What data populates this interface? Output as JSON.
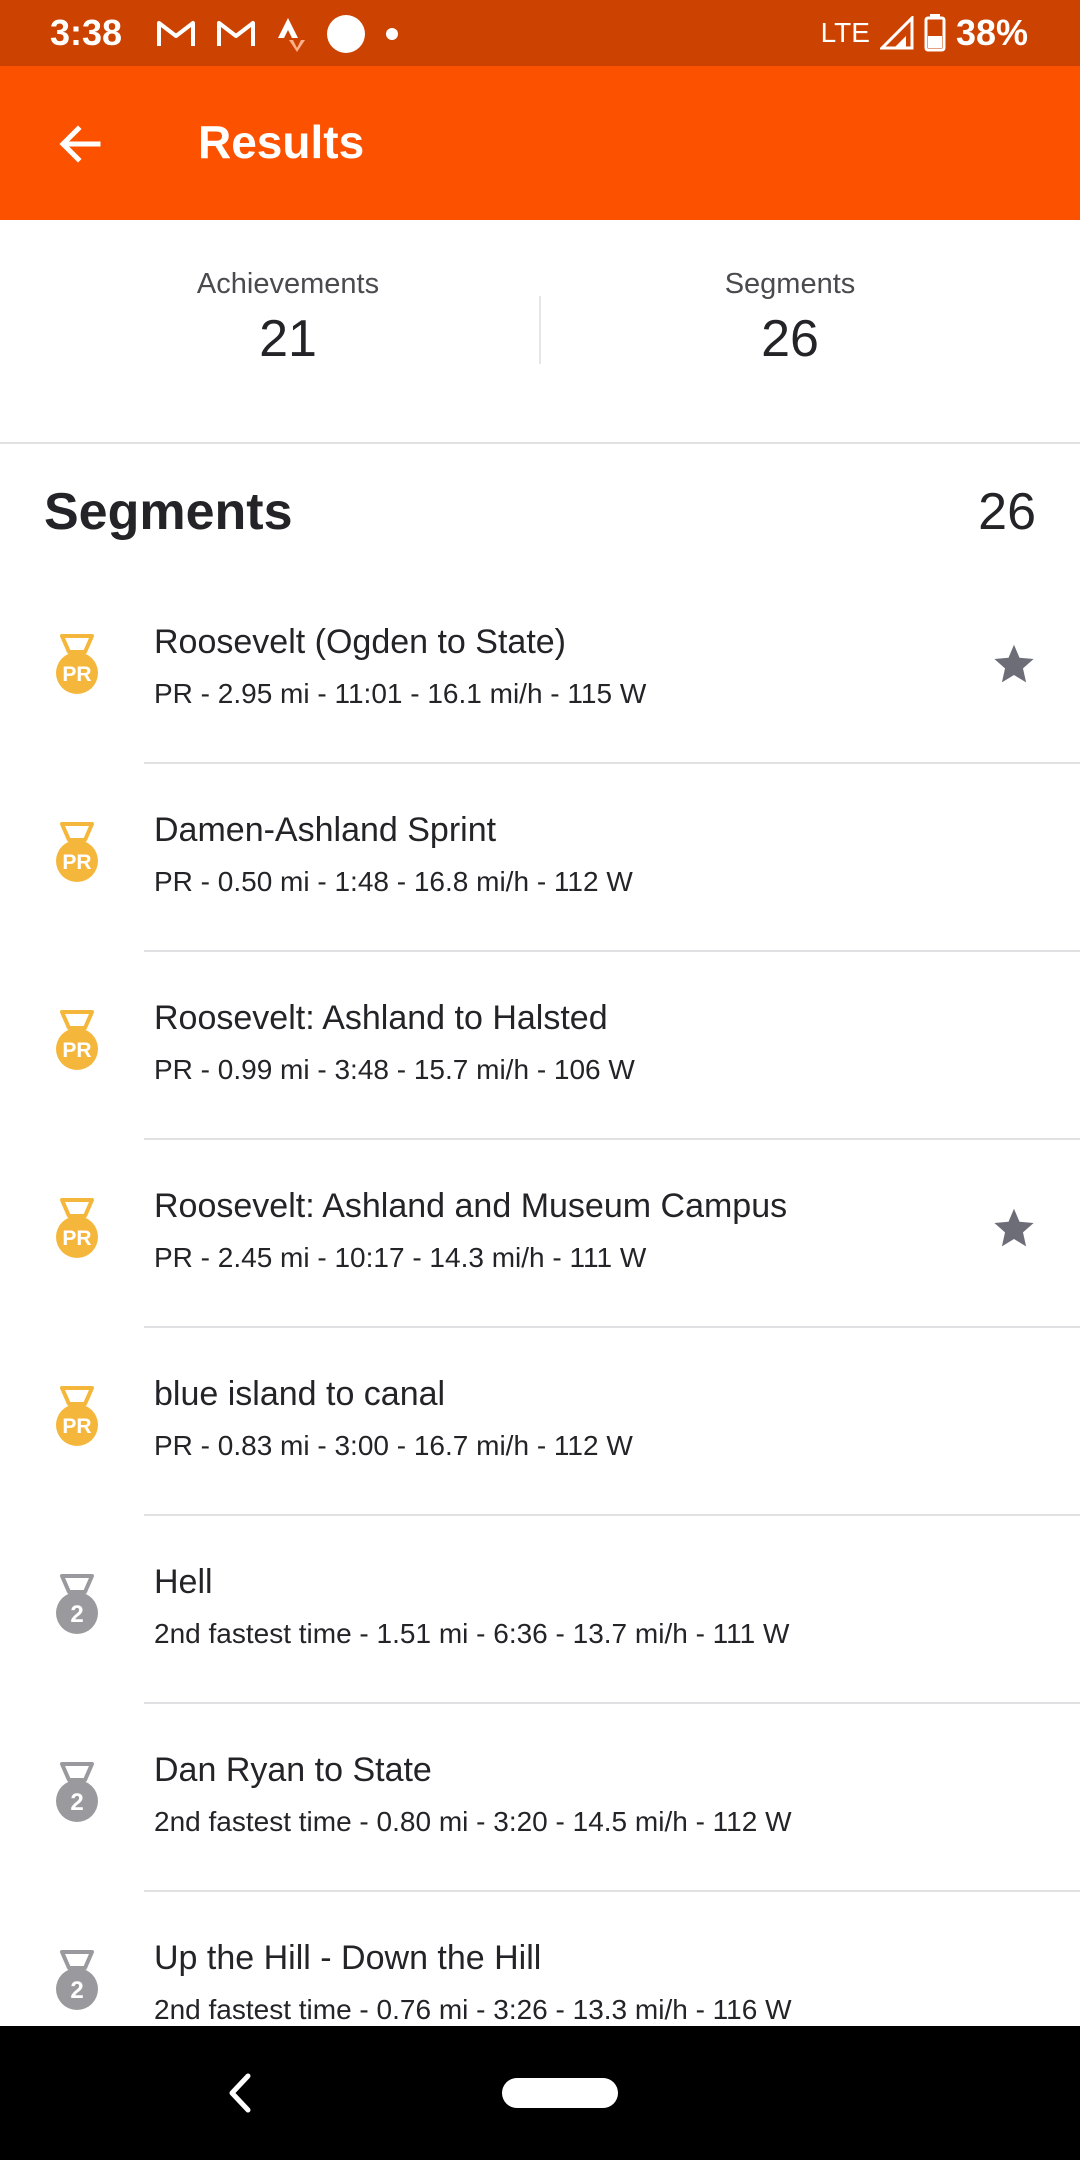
{
  "status_bar": {
    "time": "3:38",
    "network": "LTE",
    "battery": "38%"
  },
  "app_bar": {
    "title": "Results"
  },
  "summary": {
    "achievements_label": "Achievements",
    "achievements_value": "21",
    "segments_label": "Segments",
    "segments_value": "26"
  },
  "section": {
    "title": "Segments",
    "count": "26"
  },
  "colors": {
    "brand": "#fc5200",
    "status_bar": "#cc4200",
    "gold_medal": "#f5b73b",
    "silver_medal": "#9a9a9e",
    "star": "#6d6d78"
  },
  "segments": [
    {
      "name": "Roosevelt (Ogden to State)",
      "stats": "PR - 2.95 mi - 11:01 - 16.1 mi/h - 115 W",
      "medal": "PR",
      "starred": true
    },
    {
      "name": "Damen-Ashland Sprint",
      "stats": "PR - 0.50 mi - 1:48 - 16.8 mi/h - 112 W",
      "medal": "PR",
      "starred": false
    },
    {
      "name": "Roosevelt: Ashland to Halsted",
      "stats": "PR - 0.99 mi - 3:48 - 15.7 mi/h - 106 W",
      "medal": "PR",
      "starred": false
    },
    {
      "name": "Roosevelt: Ashland and Museum Campus",
      "stats": "PR - 2.45 mi - 10:17 - 14.3 mi/h - 111 W",
      "medal": "PR",
      "starred": true
    },
    {
      "name": "blue island to canal",
      "stats": "PR - 0.83 mi - 3:00 - 16.7 mi/h - 112 W",
      "medal": "PR",
      "starred": false
    },
    {
      "name": "Hell",
      "stats": "2nd fastest time - 1.51 mi - 6:36 - 13.7 mi/h - 111 W",
      "medal": "2",
      "starred": false
    },
    {
      "name": "Dan Ryan to State",
      "stats": "2nd fastest time - 0.80 mi - 3:20 - 14.5 mi/h - 112 W",
      "medal": "2",
      "starred": false
    },
    {
      "name": "Up the Hill - Down the Hill",
      "stats": "2nd fastest time - 0.76 mi - 3:26 - 13.3 mi/h - 116 W",
      "medal": "2",
      "starred": false
    }
  ]
}
